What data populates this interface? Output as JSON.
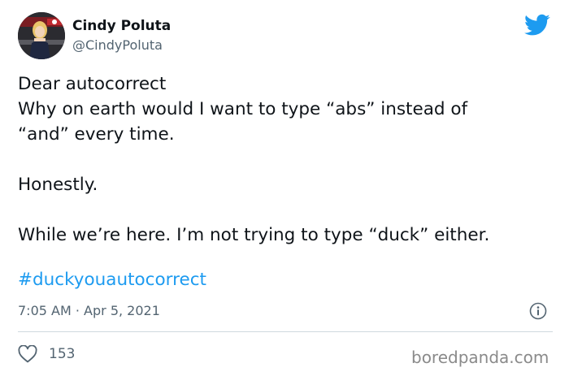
{
  "author": {
    "name": "Cindy Poluta",
    "handle": "@CindyPoluta",
    "avatar_icon": "profile-photo"
  },
  "brand": {
    "icon": "twitter-bird-icon",
    "color": "#1d9bf0"
  },
  "tweet": {
    "lines": [
      "Dear autocorrect",
      "Why on earth would I want to type “abs” instead of",
      "“and” every time.",
      "",
      "Honestly.",
      "",
      "While we’re here. I’m not trying to type “duck” either."
    ],
    "hashtag": "#duckyouautocorrect"
  },
  "meta": {
    "time": "7:05 AM",
    "separator": "·",
    "date": "Apr 5, 2021",
    "info_icon": "info-icon"
  },
  "engagement": {
    "like_icon": "heart-icon",
    "likes": "153"
  },
  "watermark": "boredpanda.com"
}
